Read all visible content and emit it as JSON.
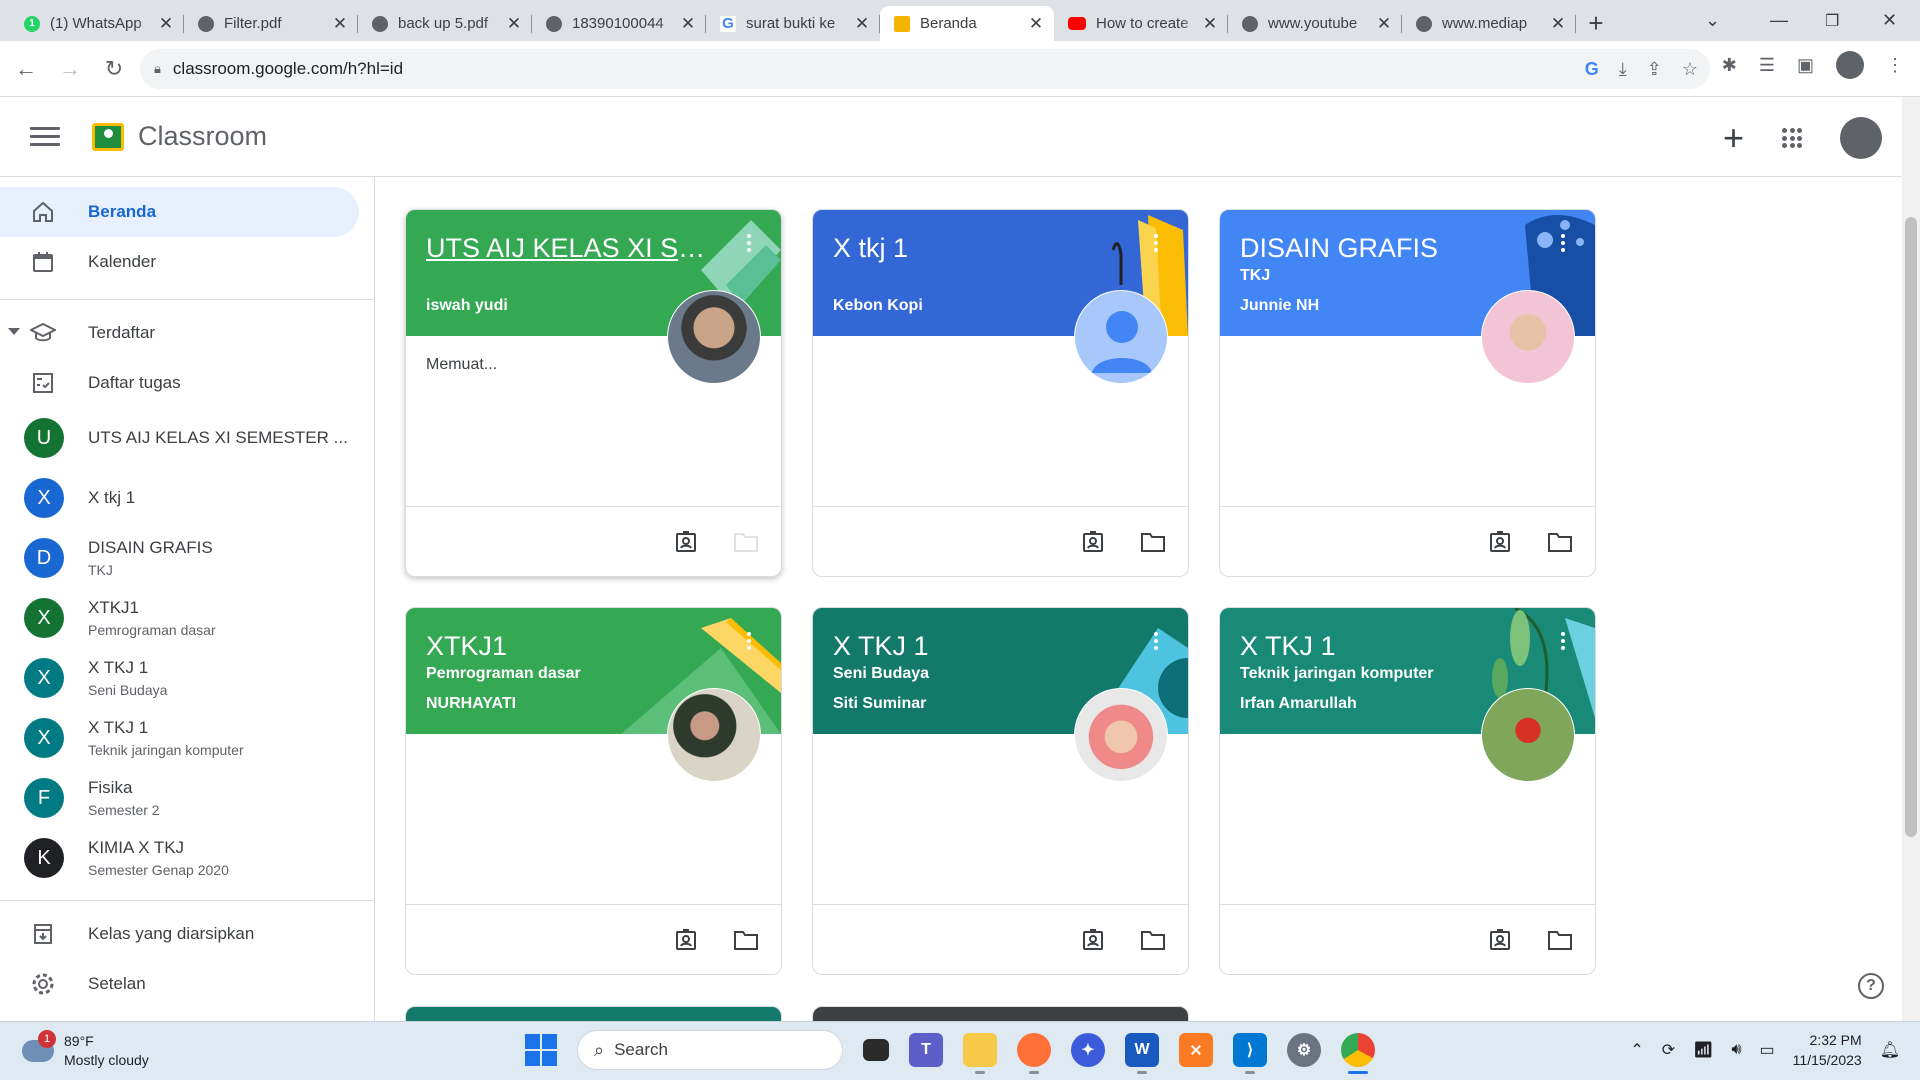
{
  "browser": {
    "tabs": [
      {
        "label": "(1) WhatsApp",
        "icon": "whatsapp-icon"
      },
      {
        "label": "Filter.pdf",
        "icon": "globe-icon"
      },
      {
        "label": "back up 5.pdf",
        "icon": "globe-icon"
      },
      {
        "label": "18390100044",
        "icon": "globe-icon"
      },
      {
        "label": "surat bukti ke",
        "icon": "google-icon"
      },
      {
        "label": "Beranda",
        "icon": "classroom-icon",
        "active": true
      },
      {
        "label": "How to create",
        "icon": "youtube-icon"
      },
      {
        "label": "www.youtube",
        "icon": "globe-icon"
      },
      {
        "label": "www.mediap",
        "icon": "globe-icon"
      }
    ],
    "url": "classroom.google.com/h?hl=id"
  },
  "app": {
    "title": "Classroom"
  },
  "sidebar": {
    "home": "Beranda",
    "calendar": "Kalender",
    "enrolled": "Terdaftar",
    "todo": "Daftar tugas",
    "classes": [
      {
        "initial": "U",
        "name": "UTS AIJ KELAS XI SEMESTER ...",
        "sub": "",
        "color": "#137333"
      },
      {
        "initial": "X",
        "name": "X tkj 1",
        "sub": "",
        "color": "#1967d2"
      },
      {
        "initial": "D",
        "name": "DISAIN GRAFIS",
        "sub": "TKJ",
        "color": "#1967d2"
      },
      {
        "initial": "X",
        "name": "XTKJ1",
        "sub": "Pemrograman dasar",
        "color": "#137333"
      },
      {
        "initial": "X",
        "name": "X TKJ 1",
        "sub": "Seni Budaya",
        "color": "#007b83"
      },
      {
        "initial": "X",
        "name": "X TKJ 1",
        "sub": "Teknik jaringan komputer",
        "color": "#007b83"
      },
      {
        "initial": "F",
        "name": "Fisika",
        "sub": "Semester 2",
        "color": "#007b83"
      },
      {
        "initial": "K",
        "name": "KIMIA X TKJ",
        "sub": "Semester Genap 2020",
        "color": "#202124"
      }
    ],
    "archived": "Kelas yang diarsipkan",
    "settings": "Setelan"
  },
  "cards": [
    {
      "title": "UTS AIJ KELAS XI SE...",
      "section": "",
      "teacher": "iswah yudi",
      "body": "Memuat...",
      "color": "#34a853"
    },
    {
      "title": "X tkj 1",
      "section": "",
      "teacher": "Kebon Kopi",
      "body": "",
      "color": "#3367d6"
    },
    {
      "title": "DISAIN GRAFIS",
      "section": "TKJ",
      "teacher": "Junnie NH",
      "body": "",
      "color": "#4285f4"
    },
    {
      "title": "XTKJ1",
      "section": "Pemrograman dasar",
      "teacher": "NURHAYATI",
      "body": "",
      "color": "#34a853"
    },
    {
      "title": "X TKJ 1",
      "section": "Seni Budaya",
      "teacher": "Siti Suminar",
      "body": "",
      "color": "#137a6b"
    },
    {
      "title": "X TKJ 1",
      "section": "Teknik jaringan komputer",
      "teacher": "Irfan Amarullah",
      "body": "",
      "color": "#1a8a78"
    }
  ],
  "taskbar": {
    "weather_temp": "89°F",
    "weather_desc": "Mostly cloudy",
    "weather_badge": "1",
    "search": "Search",
    "time": "2:32 PM",
    "date": "11/15/2023"
  }
}
